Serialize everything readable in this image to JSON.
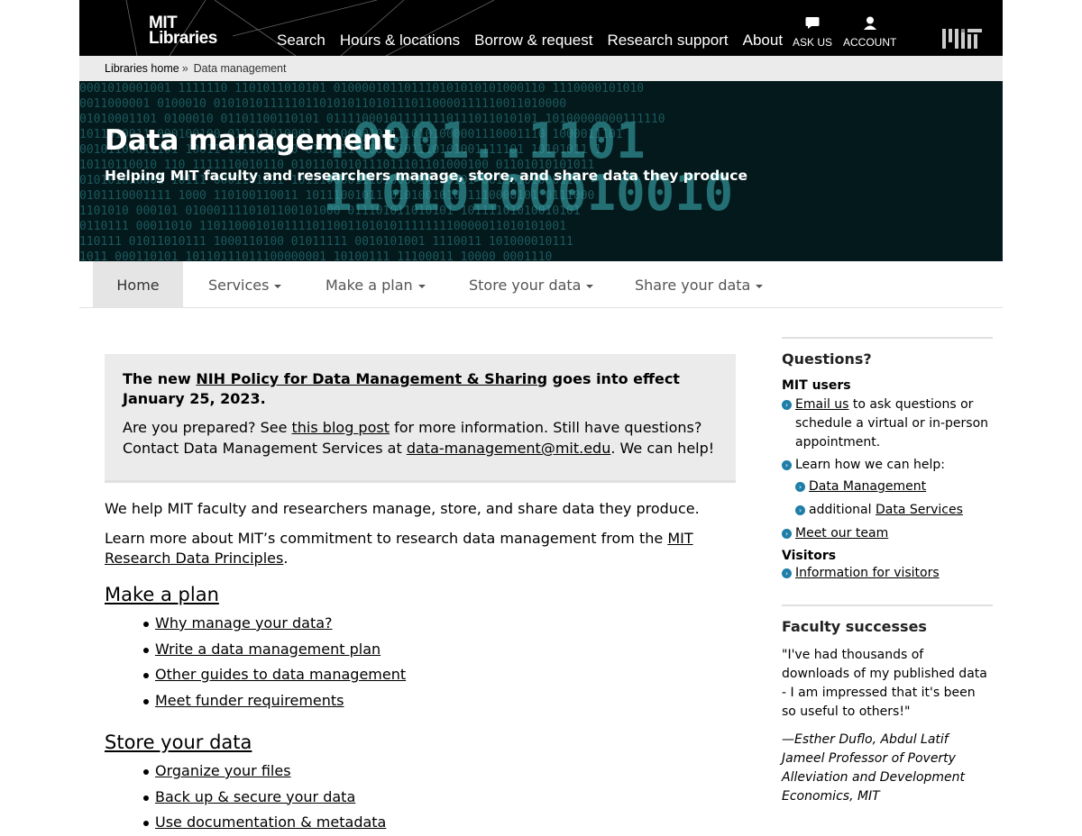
{
  "header": {
    "logo_line1": "MIT",
    "logo_line2": "Libraries",
    "nav": [
      "Search",
      "Hours & locations",
      "Borrow & request",
      "Research support",
      "About"
    ],
    "ask_us": "ASK US",
    "account": "ACCOUNT"
  },
  "breadcrumb": {
    "home": "Libraries home",
    "separator": "»",
    "current": "Data management"
  },
  "banner": {
    "title": "Data management",
    "subtitle": "Helping MIT faculty and researchers manage, store, and share data they produce"
  },
  "subnav": {
    "tabs": [
      "Home",
      "Services",
      "Make a plan",
      "Store your data",
      "Share your data"
    ]
  },
  "notice": {
    "head_pre": "The new ",
    "head_link": "NIH Policy for Data Management & Sharing",
    "head_post": " goes into effect January 25, 2023.",
    "body_pre": "Are you prepared? See ",
    "body_link": "this blog post",
    "body_mid": " for more information. Still have questions? Contact Data Management Services at ",
    "body_email": "data-management@mit.edu",
    "body_post": ". We can help!"
  },
  "main": {
    "intro1": "We help MIT faculty and researchers manage, store, and share data they produce.",
    "intro2_pre": "Learn more about MIT’s commitment to research data management from the ",
    "intro2_link": "MIT Research Data Principles",
    "intro2_post": ".",
    "sections": [
      {
        "heading": "Make a plan",
        "links": [
          "Why manage your data?",
          "Write a data management plan",
          "Other guides to data management",
          "Meet funder requirements"
        ]
      },
      {
        "heading": "Store your data",
        "links": [
          "Organize your files",
          "Back up & secure your data",
          "Use documentation & metadata"
        ]
      }
    ]
  },
  "sidebar": {
    "questions_title": "Questions?",
    "mit_users": "MIT users",
    "email_link": "Email us",
    "email_text": " to ask questions or schedule a virtual or in-person appointment.",
    "learn_text": "Learn how we can help:",
    "dm_link": "Data Management",
    "additional_text": "additional ",
    "ds_link": "Data Services",
    "team_link": "Meet our team",
    "visitors": "Visitors",
    "visitors_link": "Information for visitors",
    "faculty_title": "Faculty successes",
    "quote": "\"I've had thousands of downloads of my published data - I am impressed that it's been so useful to others!\"",
    "attribution": "—Esther Duflo, Abdul Latif Jameel Professor of Poverty Alleviation and Development Economics, MIT"
  },
  "colors": {
    "header_bg": "#000000",
    "breadcrumb_bg": "#ebebeb",
    "banner_bg": "#03191c",
    "banner_digits": "#2f8c93",
    "notice_bg": "#ebebeb",
    "bullet_icon": "#1f7ea8"
  },
  "icons": [
    "chat-bubble-icon",
    "account-person-icon",
    "mit-logo-icon",
    "circle-arrow-icon",
    "caret-down-icon"
  ]
}
